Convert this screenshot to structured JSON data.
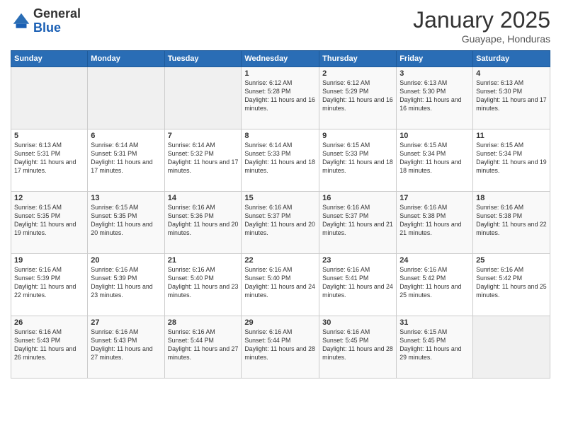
{
  "logo": {
    "general": "General",
    "blue": "Blue"
  },
  "title": "January 2025",
  "subtitle": "Guayape, Honduras",
  "days_of_week": [
    "Sunday",
    "Monday",
    "Tuesday",
    "Wednesday",
    "Thursday",
    "Friday",
    "Saturday"
  ],
  "weeks": [
    [
      {
        "day": "",
        "sunrise": "",
        "sunset": "",
        "daylight": ""
      },
      {
        "day": "",
        "sunrise": "",
        "sunset": "",
        "daylight": ""
      },
      {
        "day": "",
        "sunrise": "",
        "sunset": "",
        "daylight": ""
      },
      {
        "day": "1",
        "sunrise": "Sunrise: 6:12 AM",
        "sunset": "Sunset: 5:28 PM",
        "daylight": "Daylight: 11 hours and 16 minutes."
      },
      {
        "day": "2",
        "sunrise": "Sunrise: 6:12 AM",
        "sunset": "Sunset: 5:29 PM",
        "daylight": "Daylight: 11 hours and 16 minutes."
      },
      {
        "day": "3",
        "sunrise": "Sunrise: 6:13 AM",
        "sunset": "Sunset: 5:30 PM",
        "daylight": "Daylight: 11 hours and 16 minutes."
      },
      {
        "day": "4",
        "sunrise": "Sunrise: 6:13 AM",
        "sunset": "Sunset: 5:30 PM",
        "daylight": "Daylight: 11 hours and 17 minutes."
      }
    ],
    [
      {
        "day": "5",
        "sunrise": "Sunrise: 6:13 AM",
        "sunset": "Sunset: 5:31 PM",
        "daylight": "Daylight: 11 hours and 17 minutes."
      },
      {
        "day": "6",
        "sunrise": "Sunrise: 6:14 AM",
        "sunset": "Sunset: 5:31 PM",
        "daylight": "Daylight: 11 hours and 17 minutes."
      },
      {
        "day": "7",
        "sunrise": "Sunrise: 6:14 AM",
        "sunset": "Sunset: 5:32 PM",
        "daylight": "Daylight: 11 hours and 17 minutes."
      },
      {
        "day": "8",
        "sunrise": "Sunrise: 6:14 AM",
        "sunset": "Sunset: 5:33 PM",
        "daylight": "Daylight: 11 hours and 18 minutes."
      },
      {
        "day": "9",
        "sunrise": "Sunrise: 6:15 AM",
        "sunset": "Sunset: 5:33 PM",
        "daylight": "Daylight: 11 hours and 18 minutes."
      },
      {
        "day": "10",
        "sunrise": "Sunrise: 6:15 AM",
        "sunset": "Sunset: 5:34 PM",
        "daylight": "Daylight: 11 hours and 18 minutes."
      },
      {
        "day": "11",
        "sunrise": "Sunrise: 6:15 AM",
        "sunset": "Sunset: 5:34 PM",
        "daylight": "Daylight: 11 hours and 19 minutes."
      }
    ],
    [
      {
        "day": "12",
        "sunrise": "Sunrise: 6:15 AM",
        "sunset": "Sunset: 5:35 PM",
        "daylight": "Daylight: 11 hours and 19 minutes."
      },
      {
        "day": "13",
        "sunrise": "Sunrise: 6:15 AM",
        "sunset": "Sunset: 5:35 PM",
        "daylight": "Daylight: 11 hours and 20 minutes."
      },
      {
        "day": "14",
        "sunrise": "Sunrise: 6:16 AM",
        "sunset": "Sunset: 5:36 PM",
        "daylight": "Daylight: 11 hours and 20 minutes."
      },
      {
        "day": "15",
        "sunrise": "Sunrise: 6:16 AM",
        "sunset": "Sunset: 5:37 PM",
        "daylight": "Daylight: 11 hours and 20 minutes."
      },
      {
        "day": "16",
        "sunrise": "Sunrise: 6:16 AM",
        "sunset": "Sunset: 5:37 PM",
        "daylight": "Daylight: 11 hours and 21 minutes."
      },
      {
        "day": "17",
        "sunrise": "Sunrise: 6:16 AM",
        "sunset": "Sunset: 5:38 PM",
        "daylight": "Daylight: 11 hours and 21 minutes."
      },
      {
        "day": "18",
        "sunrise": "Sunrise: 6:16 AM",
        "sunset": "Sunset: 5:38 PM",
        "daylight": "Daylight: 11 hours and 22 minutes."
      }
    ],
    [
      {
        "day": "19",
        "sunrise": "Sunrise: 6:16 AM",
        "sunset": "Sunset: 5:39 PM",
        "daylight": "Daylight: 11 hours and 22 minutes."
      },
      {
        "day": "20",
        "sunrise": "Sunrise: 6:16 AM",
        "sunset": "Sunset: 5:39 PM",
        "daylight": "Daylight: 11 hours and 23 minutes."
      },
      {
        "day": "21",
        "sunrise": "Sunrise: 6:16 AM",
        "sunset": "Sunset: 5:40 PM",
        "daylight": "Daylight: 11 hours and 23 minutes."
      },
      {
        "day": "22",
        "sunrise": "Sunrise: 6:16 AM",
        "sunset": "Sunset: 5:40 PM",
        "daylight": "Daylight: 11 hours and 24 minutes."
      },
      {
        "day": "23",
        "sunrise": "Sunrise: 6:16 AM",
        "sunset": "Sunset: 5:41 PM",
        "daylight": "Daylight: 11 hours and 24 minutes."
      },
      {
        "day": "24",
        "sunrise": "Sunrise: 6:16 AM",
        "sunset": "Sunset: 5:42 PM",
        "daylight": "Daylight: 11 hours and 25 minutes."
      },
      {
        "day": "25",
        "sunrise": "Sunrise: 6:16 AM",
        "sunset": "Sunset: 5:42 PM",
        "daylight": "Daylight: 11 hours and 25 minutes."
      }
    ],
    [
      {
        "day": "26",
        "sunrise": "Sunrise: 6:16 AM",
        "sunset": "Sunset: 5:43 PM",
        "daylight": "Daylight: 11 hours and 26 minutes."
      },
      {
        "day": "27",
        "sunrise": "Sunrise: 6:16 AM",
        "sunset": "Sunset: 5:43 PM",
        "daylight": "Daylight: 11 hours and 27 minutes."
      },
      {
        "day": "28",
        "sunrise": "Sunrise: 6:16 AM",
        "sunset": "Sunset: 5:44 PM",
        "daylight": "Daylight: 11 hours and 27 minutes."
      },
      {
        "day": "29",
        "sunrise": "Sunrise: 6:16 AM",
        "sunset": "Sunset: 5:44 PM",
        "daylight": "Daylight: 11 hours and 28 minutes."
      },
      {
        "day": "30",
        "sunrise": "Sunrise: 6:16 AM",
        "sunset": "Sunset: 5:45 PM",
        "daylight": "Daylight: 11 hours and 28 minutes."
      },
      {
        "day": "31",
        "sunrise": "Sunrise: 6:15 AM",
        "sunset": "Sunset: 5:45 PM",
        "daylight": "Daylight: 11 hours and 29 minutes."
      },
      {
        "day": "",
        "sunrise": "",
        "sunset": "",
        "daylight": ""
      }
    ]
  ]
}
